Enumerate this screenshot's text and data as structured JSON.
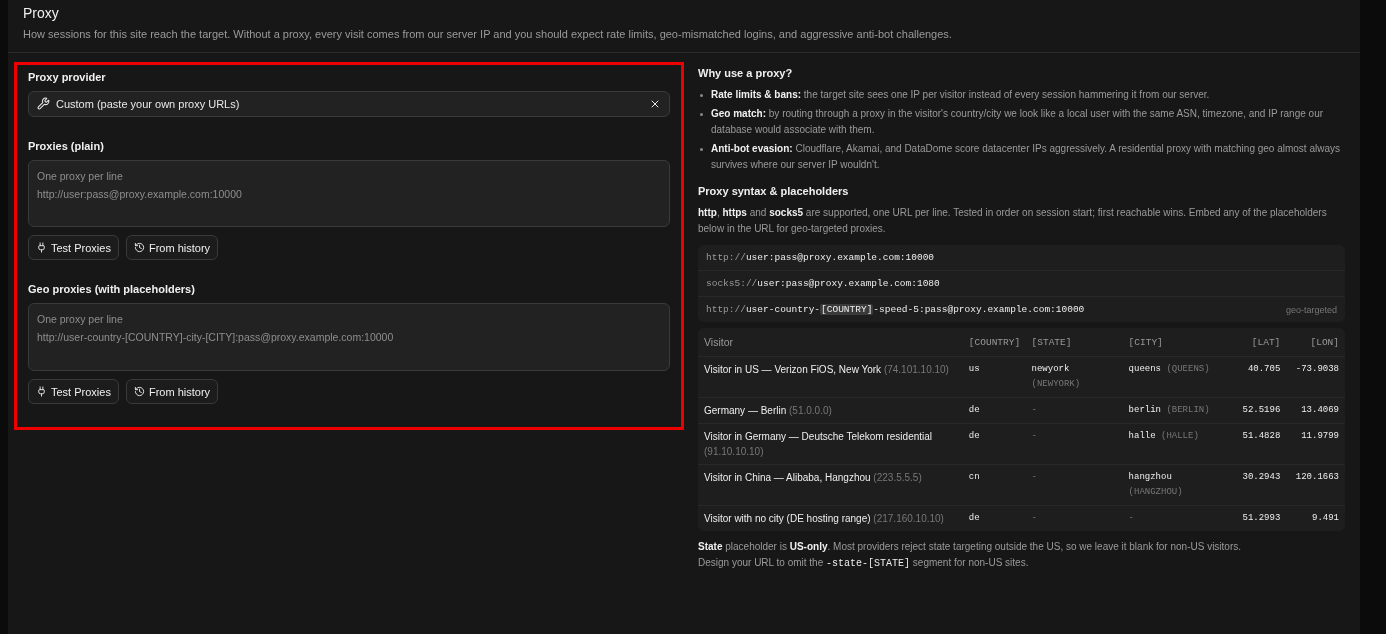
{
  "header": {
    "title": "Proxy",
    "description": "How sessions for this site reach the target. Without a proxy, every visit comes from our server IP and you should expect rate limits, geo-mismatched logins, and aggressive anti-bot challenges."
  },
  "settings": {
    "highlighted": true,
    "provider": {
      "label": "Proxy provider",
      "value": "Custom (paste your own proxy URLs)"
    },
    "groups": [
      {
        "label": "Proxies (plain)",
        "placeholder_lines": [
          "One proxy per line",
          "http://user:pass@proxy.example.com:10000"
        ],
        "buttons": [
          {
            "kind": "test",
            "label": "Test Proxies"
          },
          {
            "kind": "history",
            "label": "From history"
          }
        ]
      },
      {
        "label": "Geo proxies (with placeholders)",
        "placeholder_lines": [
          "One proxy per line",
          "http://user-country-[COUNTRY]-city-[CITY]:pass@proxy.example.com:10000"
        ],
        "buttons": [
          {
            "kind": "test",
            "label": "Test Proxies"
          },
          {
            "kind": "history",
            "label": "From history"
          }
        ]
      }
    ]
  },
  "help": {
    "why_title": "Why use a proxy?",
    "bullets": [
      "**Rate limits & bans:** the target site sees one IP per visitor instead of every session hammering it from our server.",
      "**Geo match:** by routing through a proxy in the visitor's country/city we look like a local user with the same ASN, timezone, and IP range our database would associate with them.",
      "**Anti-bot evasion:** Cloudflare, Akamai, and DataDome score datacenter IPs aggressively. A residential proxy with matching geo almost always survives where our server IP wouldn't."
    ],
    "syntax_title": "Proxy syntax & placeholders",
    "syntax_intro": "**http**, **https** and **socks5** are supported, one URL per line. Tested in order on session start; first reachable wins. Embed any of the placeholders below in the URL for geo-targeted proxies.",
    "examples": [
      {
        "parts": [
          {
            "kind": "scheme",
            "text": "http://"
          },
          {
            "kind": "plain",
            "text": "user:pass@proxy.example.com:10000"
          }
        ]
      },
      {
        "parts": [
          {
            "kind": "scheme",
            "text": "socks5://"
          },
          {
            "kind": "plain",
            "text": "user:pass@proxy.example.com:1080"
          }
        ]
      },
      {
        "parts": [
          {
            "kind": "scheme",
            "text": "http://"
          },
          {
            "kind": "plain",
            "text": "user-country-"
          },
          {
            "kind": "placeholder",
            "text": "[COUNTRY]"
          },
          {
            "kind": "plain",
            "text": "-speed-5:pass@proxy.example.com:10000"
          }
        ],
        "tag": "geo-targeted"
      }
    ],
    "table": {
      "columns": [
        "Visitor",
        "[COUNTRY]",
        "[STATE]",
        "[CITY]",
        "[LAT]",
        "[LON]"
      ],
      "rows": [
        {
          "visitor": [
            {
              "kind": "name",
              "text": "Visitor in US — Verizon FiOS, New York"
            },
            {
              "kind": "ip",
              "text": "(74.101.10.10)"
            }
          ],
          "country": "us",
          "state": "newyork",
          "state_raw": "(NEWYORK)",
          "city": "queens",
          "city_raw": "(QUEENS)",
          "lat": "40.705",
          "lon": "-73.9038"
        },
        {
          "visitor": [
            {
              "kind": "name",
              "text": "Germany — Berlin"
            },
            {
              "kind": "ip",
              "text": "(51.0.0.0)"
            }
          ],
          "country": "de",
          "state": "-",
          "city": "berlin",
          "city_raw": "(BERLIN)",
          "lat": "52.5196",
          "lon": "13.4069"
        },
        {
          "visitor": [
            {
              "kind": "name",
              "text": "Visitor in Germany — Deutsche Telekom residential"
            },
            {
              "kind": "ip",
              "text": "(91.10.10.10)"
            }
          ],
          "country": "de",
          "state": "-",
          "city": "halle",
          "city_raw": "(HALLE)",
          "lat": "51.4828",
          "lon": "11.9799"
        },
        {
          "visitor": [
            {
              "kind": "name",
              "text": "Visitor in China — Alibaba, Hangzhou"
            },
            {
              "kind": "ip",
              "text": "(223.5.5.5)"
            }
          ],
          "country": "cn",
          "state": "-",
          "city": "hangzhou",
          "city_raw": "(HANGZHOU)",
          "lat": "30.2943",
          "lon": "120.1663"
        },
        {
          "visitor": [
            {
              "kind": "name",
              "text": "Visitor with no city (DE hosting range)"
            },
            {
              "kind": "ip",
              "text": "(217.160.10.10)"
            }
          ],
          "country": "de",
          "state": "-",
          "city": "-",
          "lat": "51.2993",
          "lon": "9.491"
        }
      ]
    },
    "note_lines": [
      [
        {
          "kind": "rich",
          "text": "**State** placeholder is **US-only**. Most providers reject state targeting outside the US, so we leave it blank for non-US visitors."
        }
      ],
      [
        {
          "kind": "rich",
          "text": "Design your URL to omit the "
        },
        {
          "kind": "code",
          "text": "-state-[STATE]"
        },
        {
          "kind": "rich",
          "text": " segment for non-US sites."
        }
      ]
    ]
  }
}
